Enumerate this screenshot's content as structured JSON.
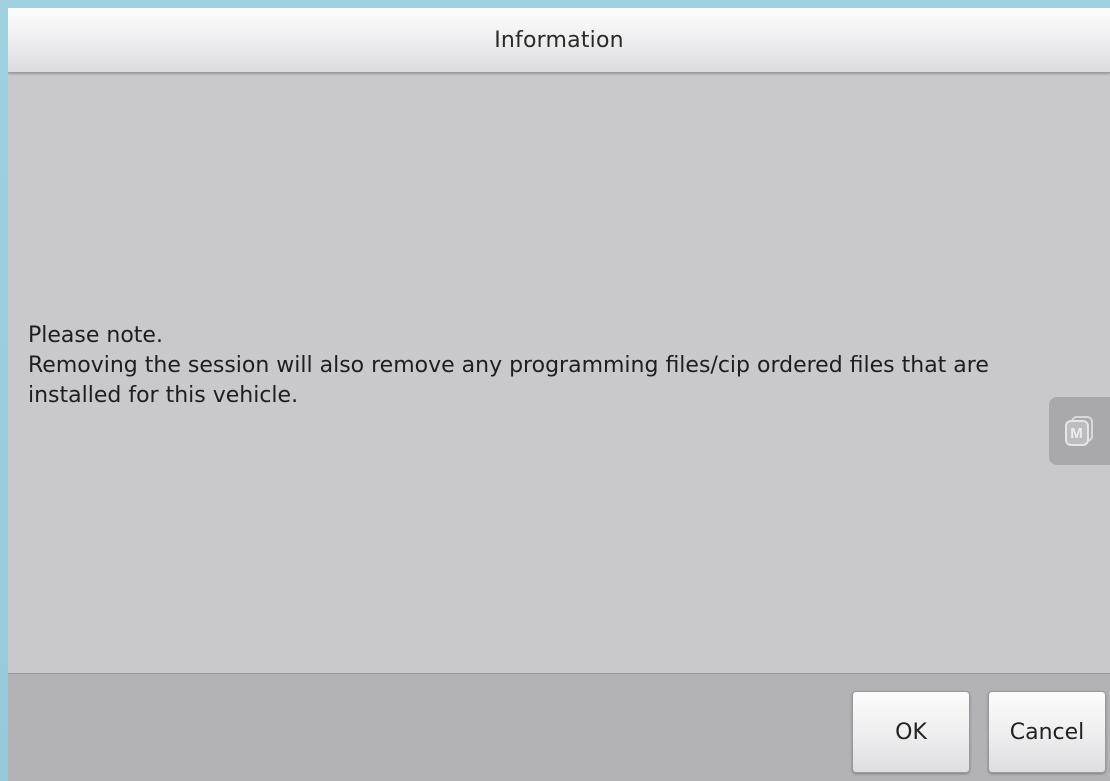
{
  "dialog": {
    "title": "Information",
    "message_line1": "Please note.",
    "message_line2": "Removing the session will also remove any programming files/cip ordered files that are installed for this vehicle."
  },
  "floating_button": {
    "icon": "multi-window-m-icon",
    "glyph": "M"
  },
  "footer": {
    "ok_label": "OK",
    "cancel_label": "Cancel"
  },
  "colors": {
    "frame": "#9ecfdf",
    "dialog_body": "#c9c9cc",
    "footer": "#b3b3b6"
  }
}
